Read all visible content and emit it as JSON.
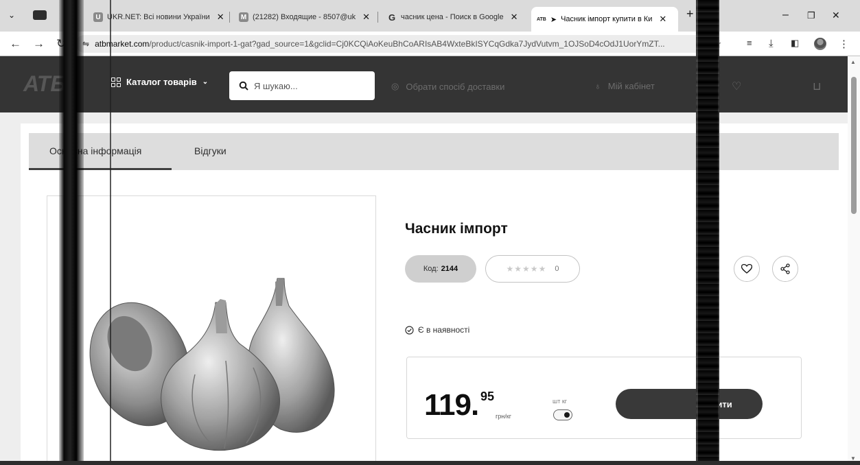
{
  "browser": {
    "tabs": [
      {
        "title": "UKR.NET: Всі новини України",
        "favicon": "U"
      },
      {
        "title": "(21282) Входящие - 8507@uk",
        "favicon": "M"
      },
      {
        "title": "часник цена - Поиск в Google",
        "favicon": "G"
      },
      {
        "title": "Часник імпорт купити в Ки",
        "favicon": "ATB"
      }
    ],
    "active_tab_index": 3,
    "new_tab_label": "+",
    "url_host": "atbmarket.com",
    "url_rest": "/product/casnik-import-1-gat?gad_source=1&gclid=Cj0KCQiAoKeuBhCoARIsAB4WxteBkISYCqGdka7JydVutvm_1OJSoD4cOdJ1UorYmZT..."
  },
  "site": {
    "logo_text": "АТБ",
    "catalog_label": "Каталог товарів",
    "search_placeholder": "Я шукаю...",
    "delivery_label": "Обрати спосіб доставки",
    "account_label": "Мій кабінет"
  },
  "product_tabs": [
    "Основна інформація",
    "Відгуки"
  ],
  "product": {
    "title": "Часник імпорт",
    "code_label": "Код:",
    "code": "2144",
    "rating_count": "0",
    "stock_label": "Є в наявності",
    "price_int": "119.",
    "price_dec": "95",
    "price_unit": "грн/кг",
    "unit_labels": "шт кг",
    "unit_selected": "кг",
    "buy_label": "Купити"
  },
  "colors": {
    "header_bg": "#3a3a3a",
    "buy_button": "#3e3e3e"
  }
}
